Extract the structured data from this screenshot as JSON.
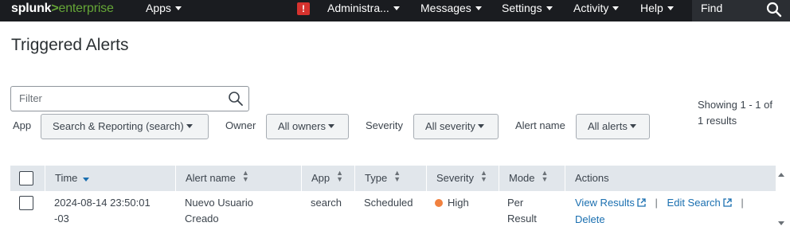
{
  "nav": {
    "logo_brand": "splunk",
    "logo_sep": ">",
    "logo_product": "enterprise",
    "apps_label": "Apps",
    "alert_badge": "!",
    "admin_label": "Administra...",
    "messages_label": "Messages",
    "settings_label": "Settings",
    "activity_label": "Activity",
    "help_label": "Help",
    "find_label": "Find"
  },
  "page": {
    "title": "Triggered Alerts"
  },
  "filters": {
    "filter_placeholder": "Filter",
    "app_label": "App",
    "app_value": "Search & Reporting (search)",
    "owner_label": "Owner",
    "owner_value": "All owners",
    "severity_label": "Severity",
    "severity_value": "All severity",
    "alertname_label": "Alert name",
    "alertname_value": "All alerts"
  },
  "pagination": {
    "showing_line1": "Showing 1 - 1 of",
    "showing_line2": "1 results"
  },
  "table": {
    "columns": [
      "Time",
      "Alert name",
      "App",
      "Type",
      "Severity",
      "Mode",
      "Actions"
    ],
    "rows": [
      {
        "time_line1": "2024-08-14 23:50:01",
        "time_line2": "-03",
        "alert_line1": "Nuevo Usuario",
        "alert_line2": "Creado",
        "app": "search",
        "type": "Scheduled",
        "severity": "High",
        "severity_color": "#f1813f",
        "mode_line1": "Per",
        "mode_line2": "Result",
        "action_view": "View Results",
        "action_edit": "Edit Search",
        "action_delete": "Delete"
      }
    ]
  },
  "colors": {
    "topbar": "#1a1c20",
    "logo_accent": "#65a637",
    "link": "#1a6fb0",
    "header_bg": "#e1e6eb",
    "alert_badge": "#d6322e"
  }
}
